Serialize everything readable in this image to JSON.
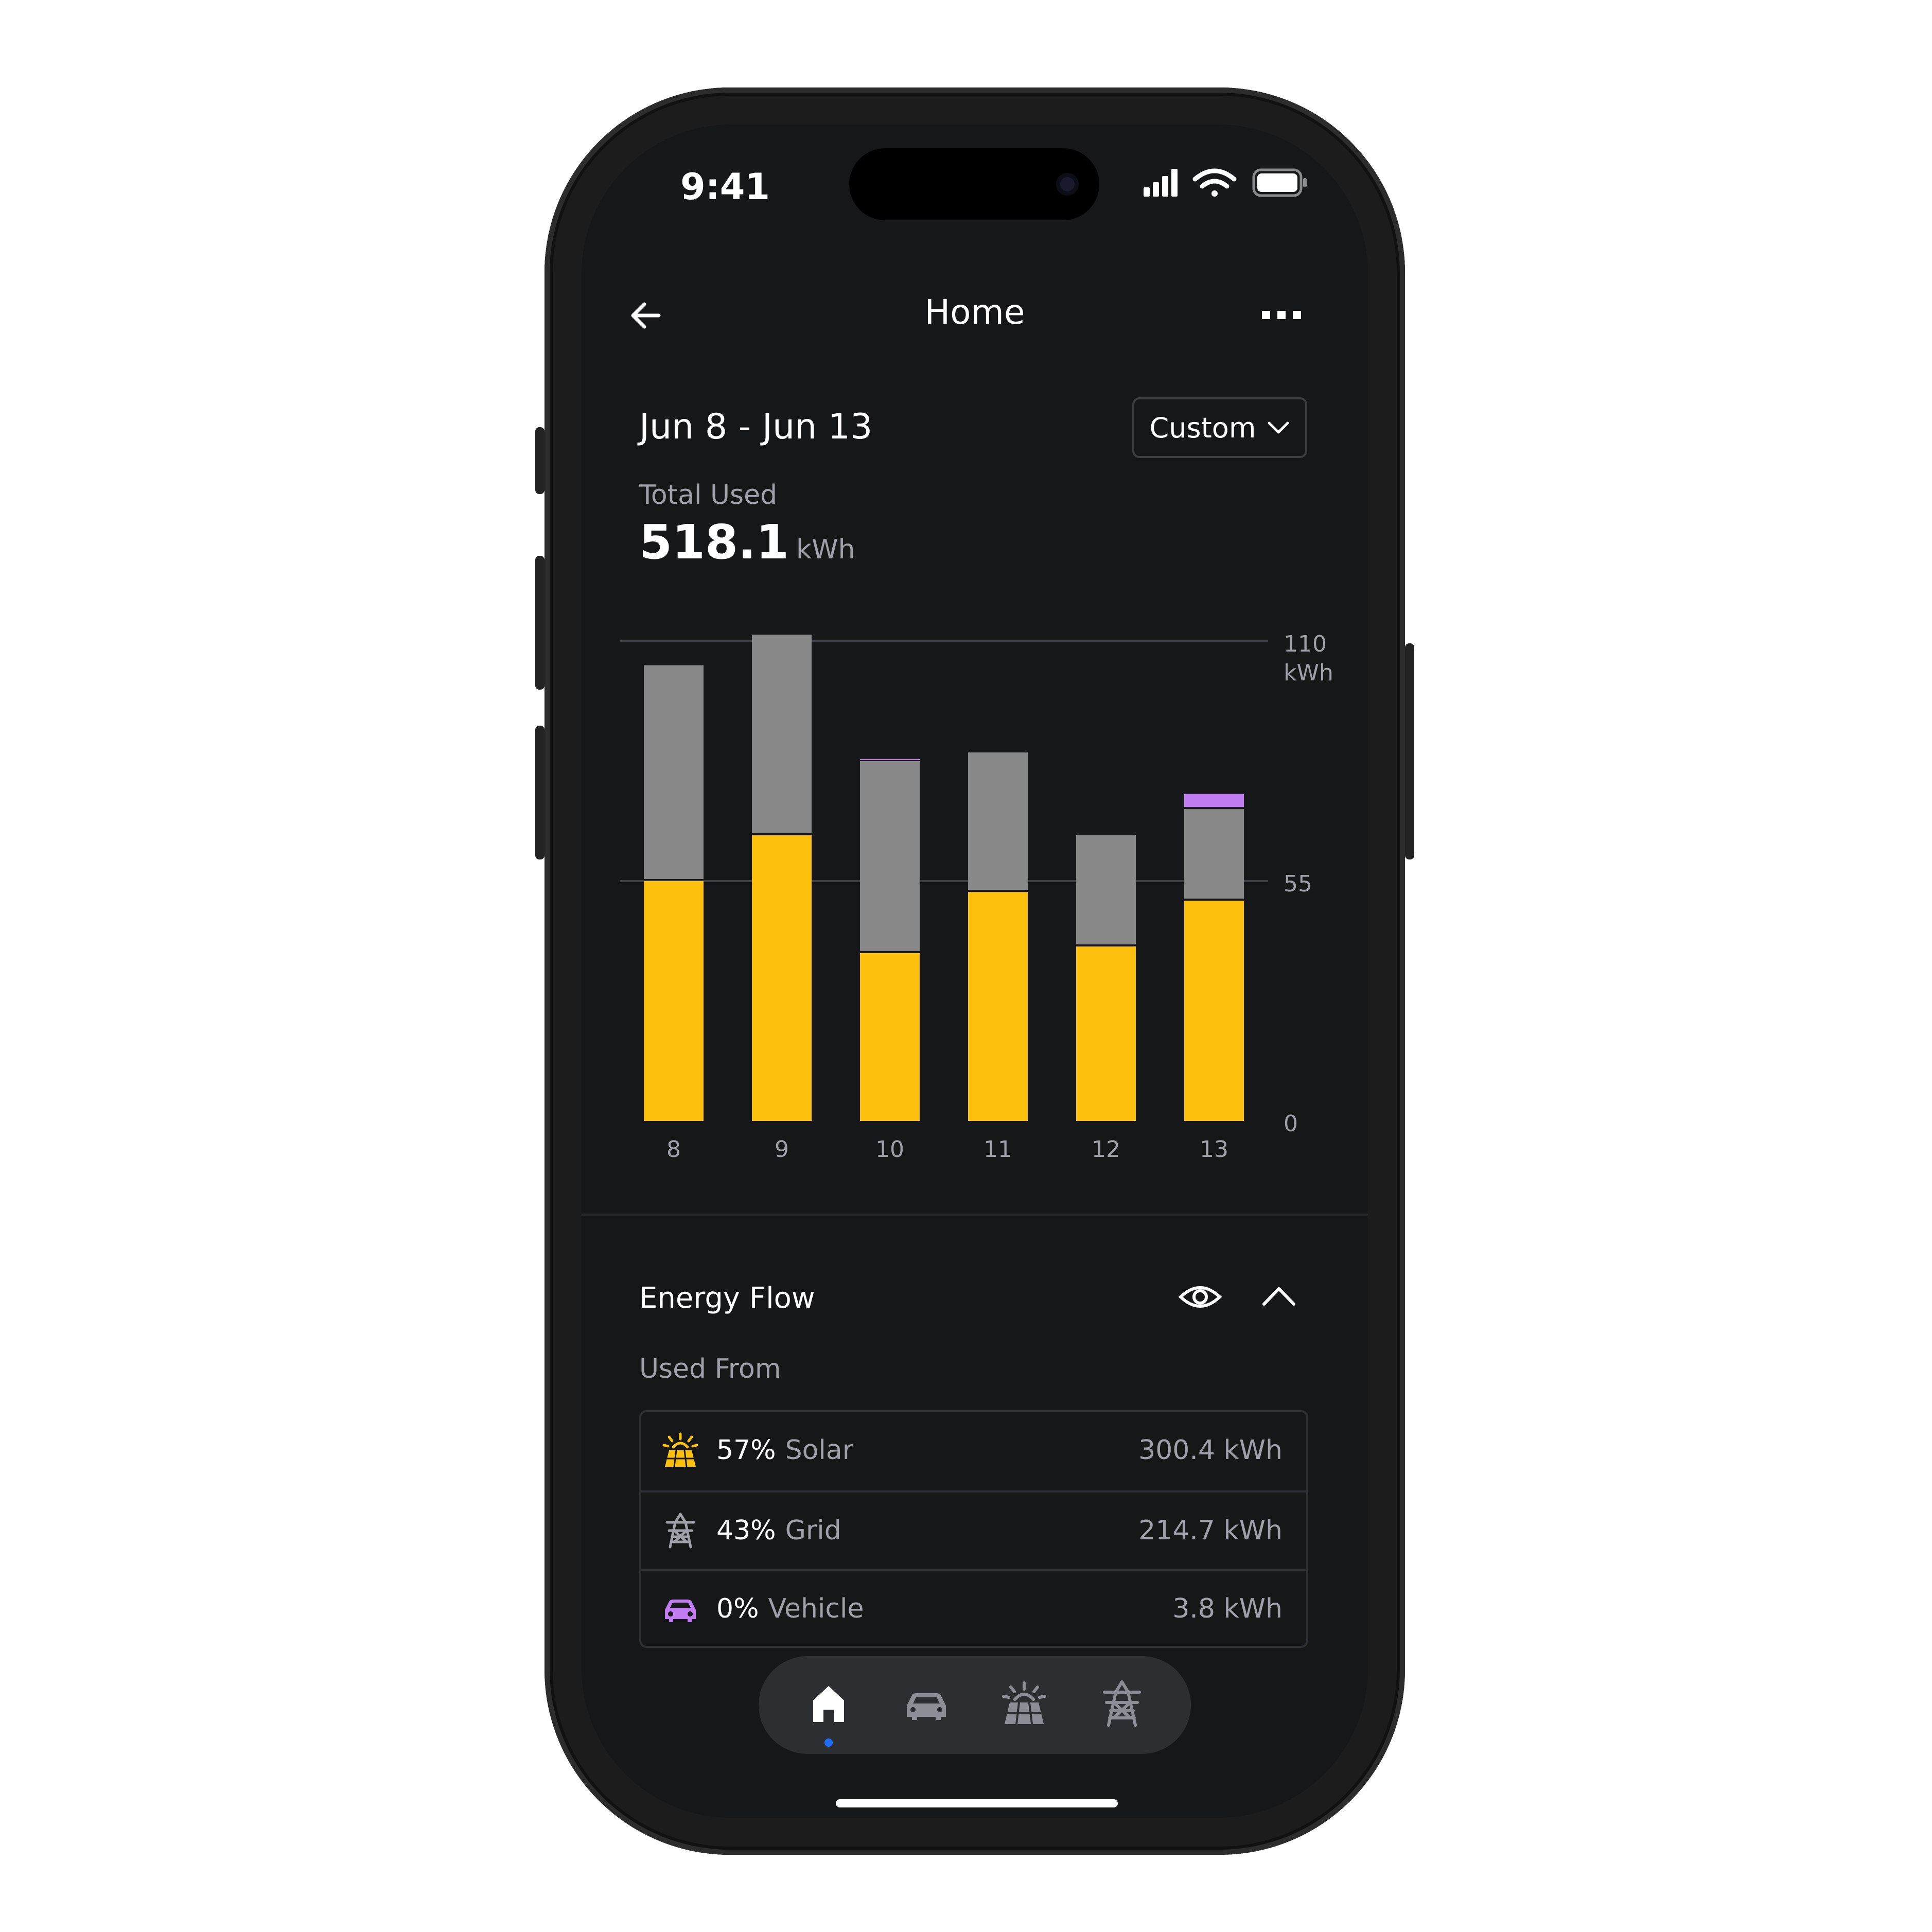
{
  "status_bar": {
    "time": "9:41"
  },
  "header": {
    "title": "Home",
    "back_icon": "arrow-left-icon",
    "more_icon": "ellipsis-icon"
  },
  "date_range": "Jun 8 - Jun 13",
  "range_selector": {
    "label": "Custom",
    "icon": "chevron-down-icon"
  },
  "total": {
    "label": "Total Used",
    "value": "518.1",
    "unit": "kWh"
  },
  "colors": {
    "solar": "#fdc00d",
    "grid": "#888888",
    "vehicle": "#c07cf0",
    "accent": "#1e6fff",
    "background": "#151719"
  },
  "chart_data": {
    "type": "bar",
    "stacked": true,
    "categories": [
      "8",
      "9",
      "10",
      "11",
      "12",
      "13"
    ],
    "series": [
      {
        "name": "Solar",
        "color": "#fdc00d",
        "values": [
          55.0,
          65.5,
          38.5,
          52.5,
          40.0,
          50.5
        ]
      },
      {
        "name": "Grid",
        "color": "#888888",
        "values": [
          49.5,
          46.0,
          44.0,
          32.0,
          25.5,
          21.0
        ]
      },
      {
        "name": "Vehicle",
        "color": "#c07cf0",
        "values": [
          0,
          0,
          0.5,
          0,
          0,
          3.5
        ]
      }
    ],
    "y_ticks": [
      "0",
      "55",
      "110"
    ],
    "y_unit": "kWh",
    "ylim": [
      0,
      110
    ],
    "grid": true
  },
  "energy_flow": {
    "title": "Energy Flow",
    "subtitle": "Used From",
    "rows": [
      {
        "icon": "solar-panel-icon",
        "percent": "57%",
        "name": "Solar",
        "value": "300.4 kWh"
      },
      {
        "icon": "power-tower-icon",
        "percent": "43%",
        "name": "Grid",
        "value": "214.7 kWh"
      },
      {
        "icon": "car-icon",
        "percent": "0%",
        "name": "Vehicle",
        "value": "3.8 kWh"
      }
    ]
  },
  "tab_bar": {
    "tabs": [
      "home-icon",
      "car-icon",
      "solar-panel-icon",
      "power-tower-icon"
    ],
    "active": "home-icon"
  }
}
